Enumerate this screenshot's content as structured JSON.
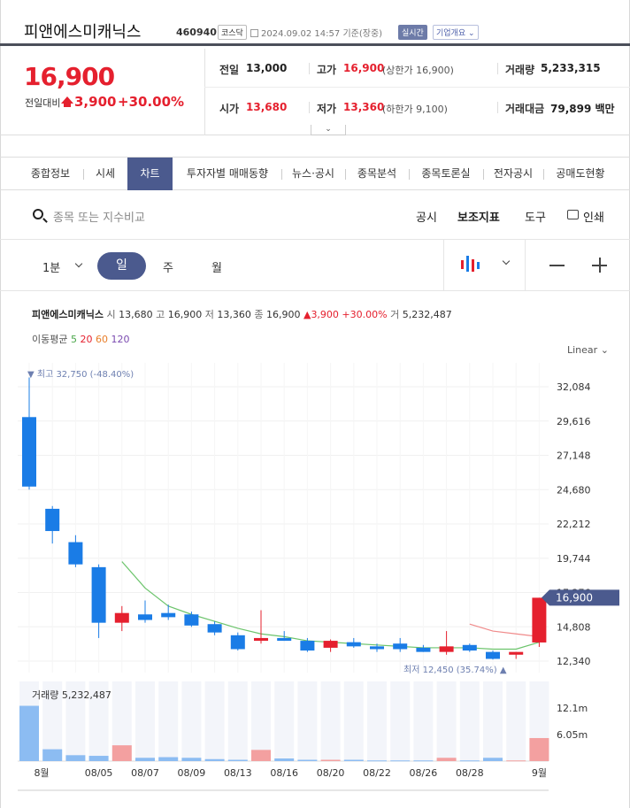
{
  "header": {
    "name": "피앤에스미캐닉스",
    "code": "460940",
    "market": "코스닥",
    "datetime": "2024.09.02 14:57",
    "datetime_suffix": "기준(장중)",
    "live_badge": "실시간",
    "company_button": "기업개요"
  },
  "quote": {
    "price": "16,900",
    "change_label": "전일대비",
    "change": "3,900",
    "change_pct": "+30.00%",
    "prev_label": "전일",
    "prev": "13,000",
    "high_label": "고가",
    "high": "16,900",
    "upper_limit": "(상한가 16,900)",
    "volume_label": "거래량",
    "volume": "5,233,315",
    "open_label": "시가",
    "open": "13,680",
    "low_label": "저가",
    "low": "13,360",
    "lower_limit": "(하한가 9,100)",
    "amount_label": "거래대금",
    "amount": "79,899 백만"
  },
  "tabs": [
    "종합정보",
    "시세",
    "차트",
    "투자자별 매매동향",
    "뉴스·공시",
    "종목분석",
    "종목토론실",
    "전자공시",
    "공매도현황"
  ],
  "toolbar": {
    "search_placeholder": "종목 또는 지수비교",
    "notice": "공시",
    "indicator": "보조지표",
    "tools": "도구",
    "print": "인쇄"
  },
  "periods": {
    "minute": "1분",
    "day": "일",
    "week": "주",
    "month": "월"
  },
  "colors": {
    "up": "#e5202e",
    "down": "#1a7ce6",
    "accent": "#4b5a8e"
  },
  "chart_info": {
    "name": "피앤에스미캐닉스",
    "open_label": "시",
    "open": "13,680",
    "high_label": "고",
    "high": "16,900",
    "low_label": "저",
    "low": "13,360",
    "close_label": "종",
    "close": "16,900",
    "change": "3,900 +30.00%",
    "volume_label": "거",
    "volume": "5,232,487"
  },
  "ma": {
    "label": "이동평균",
    "p5": "5",
    "p20": "20",
    "p60": "60",
    "p120": "120"
  },
  "scale_label": "Linear",
  "chart_data": {
    "type": "candlestick",
    "y_ticks": [
      "32,084",
      "29,616",
      "27,148",
      "24,680",
      "22,212",
      "19,744",
      "17,276",
      "14,808",
      "12,340"
    ],
    "ylim": [
      12340,
      32084
    ],
    "current_price_label": "16,900",
    "max_annotation": "최고 32,750 (-48.40%)",
    "min_annotation": "최저 12,450 (35.74%)",
    "candles": [
      {
        "o": 29900,
        "h": 32750,
        "l": 24680,
        "c": 24900
      },
      {
        "o": 23300,
        "h": 23500,
        "l": 20800,
        "c": 21700
      },
      {
        "o": 20900,
        "h": 21400,
        "l": 19100,
        "c": 19300
      },
      {
        "o": 19100,
        "h": 19300,
        "l": 14000,
        "c": 15100
      },
      {
        "o": 15100,
        "h": 16300,
        "l": 14500,
        "c": 15800
      },
      {
        "o": 15700,
        "h": 16700,
        "l": 15100,
        "c": 15300
      },
      {
        "o": 15800,
        "h": 16400,
        "l": 15300,
        "c": 15500
      },
      {
        "o": 15700,
        "h": 15900,
        "l": 14800,
        "c": 14900
      },
      {
        "o": 15000,
        "h": 15200,
        "l": 14200,
        "c": 14400
      },
      {
        "o": 14200,
        "h": 14400,
        "l": 13100,
        "c": 13200
      },
      {
        "o": 13800,
        "h": 16000,
        "l": 13600,
        "c": 14000
      },
      {
        "o": 14000,
        "h": 14500,
        "l": 13800,
        "c": 13800
      },
      {
        "o": 13800,
        "h": 14000,
        "l": 13000,
        "c": 13100
      },
      {
        "o": 13300,
        "h": 13900,
        "l": 13000,
        "c": 13800
      },
      {
        "o": 13700,
        "h": 14000,
        "l": 13300,
        "c": 13400
      },
      {
        "o": 13400,
        "h": 13600,
        "l": 13000,
        "c": 13200
      },
      {
        "o": 13600,
        "h": 14000,
        "l": 13000,
        "c": 13200
      },
      {
        "o": 13300,
        "h": 13500,
        "l": 13000,
        "c": 13000
      },
      {
        "o": 13000,
        "h": 14500,
        "l": 12800,
        "c": 13400
      },
      {
        "o": 13500,
        "h": 13600,
        "l": 13000,
        "c": 13100
      },
      {
        "o": 13000,
        "h": 13100,
        "l": 12450,
        "c": 12500
      },
      {
        "o": 12800,
        "h": 13000,
        "l": 12500,
        "c": 13000
      },
      {
        "o": 13680,
        "h": 16900,
        "l": 13360,
        "c": 16900
      }
    ],
    "ma_line": [
      {
        "i": 4,
        "v": 19500
      },
      {
        "i": 5,
        "v": 17600
      },
      {
        "i": 6,
        "v": 16300
      },
      {
        "i": 7,
        "v": 15700
      },
      {
        "i": 8,
        "v": 15200
      },
      {
        "i": 9,
        "v": 14700
      },
      {
        "i": 10,
        "v": 14300
      },
      {
        "i": 11,
        "v": 14100
      },
      {
        "i": 12,
        "v": 13800
      },
      {
        "i": 13,
        "v": 13700
      },
      {
        "i": 14,
        "v": 13600
      },
      {
        "i": 15,
        "v": 13500
      },
      {
        "i": 16,
        "v": 13400
      },
      {
        "i": 17,
        "v": 13300
      },
      {
        "i": 18,
        "v": 13300
      },
      {
        "i": 19,
        "v": 13300
      },
      {
        "i": 20,
        "v": 13200
      },
      {
        "i": 21,
        "v": 13200
      },
      {
        "i": 22,
        "v": 13700
      }
    ],
    "ma_line2": [
      {
        "i": 19,
        "v": 15000
      },
      {
        "i": 20,
        "v": 14500
      },
      {
        "i": 21,
        "v": 14300
      },
      {
        "i": 22,
        "v": 14100
      }
    ],
    "volume_label": "거래량",
    "volume_value": "5,232,487",
    "volume_ticks": [
      "12.1m",
      "6.05m"
    ],
    "volume_max": 12100000,
    "volumes": [
      8400000,
      1800000,
      900000,
      800000,
      2400000,
      500000,
      600000,
      500000,
      300000,
      200000,
      1700000,
      400000,
      200000,
      200000,
      200000,
      100000,
      100000,
      100000,
      500000,
      100000,
      500000,
      100000,
      3500000
    ],
    "x_labels": [
      "8월",
      "08/05",
      "08/07",
      "08/09",
      "08/13",
      "08/16",
      "08/20",
      "08/22",
      "08/26",
      "08/28",
      "9월"
    ]
  }
}
